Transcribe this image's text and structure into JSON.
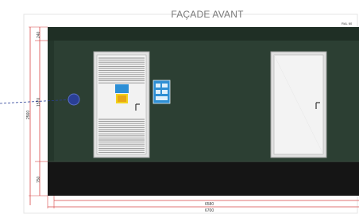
{
  "drawing": {
    "title": "FAÇADE AVANT",
    "ral_note": "RAL 60"
  },
  "dimensions": {
    "top_band": "240",
    "middle_band": "1570",
    "overall_height": "2560",
    "bottom_band": "750",
    "inner_width": "6580",
    "overall_width": "6700"
  },
  "colors": {
    "wall": "#2c3f33",
    "roof": "#1f2f25",
    "base": "#151515",
    "door_frame": "#d9d9d9",
    "dimension_line": "#d84848",
    "marker": "#2a3f96"
  }
}
